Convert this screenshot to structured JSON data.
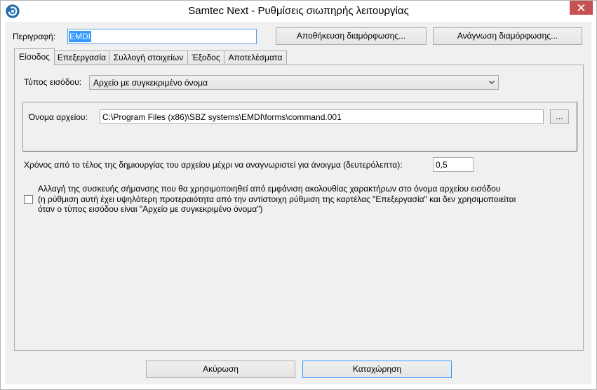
{
  "window": {
    "title": "Samtec Next - Ρυθμίσεις σιωπηρής λειτουργίας",
    "app_icon": "samtec-app-icon",
    "close_icon": "close-icon"
  },
  "header": {
    "description_label": "Περιγραφή:",
    "description_value": "EMDI",
    "save_config_label": "Αποθήκευση διαμόρφωσης...",
    "read_config_label": "Ανάγνωση διαμόρφωσης..."
  },
  "tabs": [
    {
      "label": "Είσοδος",
      "selected": true
    },
    {
      "label": "Επεξεργασία",
      "selected": false
    },
    {
      "label": "Συλλογή στοιχείων",
      "selected": false
    },
    {
      "label": "Έξοδος",
      "selected": false
    },
    {
      "label": "Αποτελέσματα",
      "selected": false
    }
  ],
  "input_tab": {
    "input_type_label": "Τύπος εισόδου:",
    "input_type_value": "Αρχείο με συγκεκριμένο όνομα",
    "chevron_icon": "chevron-down-icon",
    "file_name_label": "Όνομα αρχείου:",
    "file_name_value": "C:\\Program Files (x86)\\SBZ systems\\EMDI\\forms\\command.001",
    "browse_label": "...",
    "wait_time_label": "Χρόνος από το τέλος της δημιουργίας του αρχείου μέχρι να αναγνωριστεί για άνοιγμα (δευτερόλεπτα):",
    "wait_time_value": "0,5",
    "marker_device_checkbox": {
      "checked": false,
      "lines": [
        "Αλλαγή της συσκευής σήμανσης που θα χρησιμοποιηθεί από εμφάνιση ακολουθίας χαρακτήρων στο όνομα αρχείου εισόδου",
        "(η ρύθμιση αυτή έχει υψηλότερη προτεραιότητα από την αντίστοιχη ρύθμιση της καρτέλας \"Επεξεργασία\" και δεν χρησιμοποιείται",
        "όταν ο τύπος εισόδου είναι \"Αρχείο με συγκεκριμένο όνομα\")"
      ]
    }
  },
  "footer": {
    "cancel_label": "Ακύρωση",
    "ok_label": "Καταχώρηση"
  },
  "colors": {
    "close_button": "#C75050",
    "selection_highlight": "#3399FF",
    "focus_border": "#569DE5",
    "default_button_border": "#3399FF",
    "dialog_background": "#F0F0F0"
  }
}
